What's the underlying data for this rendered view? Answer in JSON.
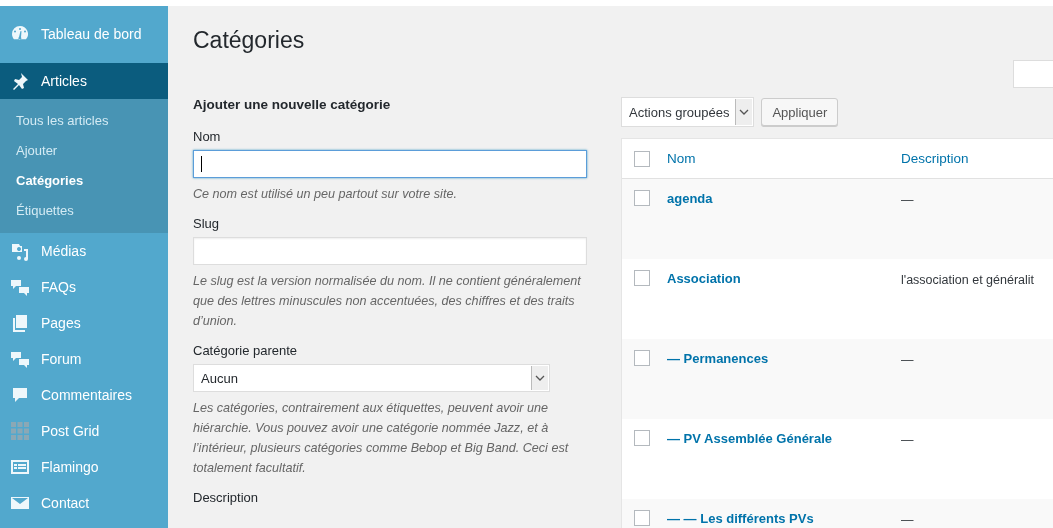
{
  "sidebar": {
    "items": [
      {
        "label": "Tableau de bord",
        "kind": "dashboard",
        "selected": false
      },
      {
        "label": "Articles",
        "kind": "pin",
        "selected": true,
        "children": [
          {
            "label": "Tous les articles",
            "selected": false
          },
          {
            "label": "Ajouter",
            "selected": false
          },
          {
            "label": "Catégories",
            "selected": true
          },
          {
            "label": "Étiquettes",
            "selected": false
          }
        ]
      },
      {
        "label": "Médias",
        "kind": "media",
        "selected": false
      },
      {
        "label": "FAQs",
        "kind": "bubbles",
        "selected": false
      },
      {
        "label": "Pages",
        "kind": "pages",
        "selected": false
      },
      {
        "label": "Forum",
        "kind": "bubbles",
        "selected": false
      },
      {
        "label": "Commentaires",
        "kind": "bubble",
        "selected": false
      },
      {
        "label": "Post Grid",
        "kind": "grid",
        "selected": false
      },
      {
        "label": "Flamingo",
        "kind": "card",
        "selected": false
      },
      {
        "label": "Contact",
        "kind": "mail",
        "selected": false
      }
    ]
  },
  "page_title": "Catégories",
  "form": {
    "heading": "Ajouter une nouvelle catégorie",
    "fields": [
      {
        "kind": "text",
        "label": "Nom",
        "focused": true,
        "help": "Ce nom est utilisé un peu partout sur votre site."
      },
      {
        "kind": "text",
        "label": "Slug",
        "focused": false,
        "help": "Le slug est la version normalisée du nom. Il ne contient généralement que des lettres minuscules non accentuées, des chiffres et des traits d’union."
      },
      {
        "kind": "select",
        "label": "Catégorie parente",
        "value": "Aucun",
        "help": "Les catégories, contrairement aux étiquettes, peuvent avoir une hiérarchie. Vous pouvez avoir une catégorie nommée Jazz, et à l’intérieur, plusieurs catégories comme Bebop et Big Band. Ceci est totalement facultatif."
      },
      {
        "kind": "label",
        "label": "Description"
      }
    ]
  },
  "bulk_actions": {
    "value": "Actions groupées",
    "button": "Appliquer"
  },
  "table": {
    "columns": [
      "Nom",
      "Description"
    ],
    "header_checked": false,
    "rows": [
      {
        "name": "agenda",
        "description": "—",
        "checked": false
      },
      {
        "name": "Association",
        "description": "l'association et généralit",
        "checked": false
      },
      {
        "name": "— Permanences",
        "description": "—",
        "checked": false
      },
      {
        "name": "— PV Assemblée Générale",
        "description": "—",
        "checked": false
      },
      {
        "name": "— — Les différents PVs",
        "description": "—",
        "checked": false
      }
    ]
  }
}
